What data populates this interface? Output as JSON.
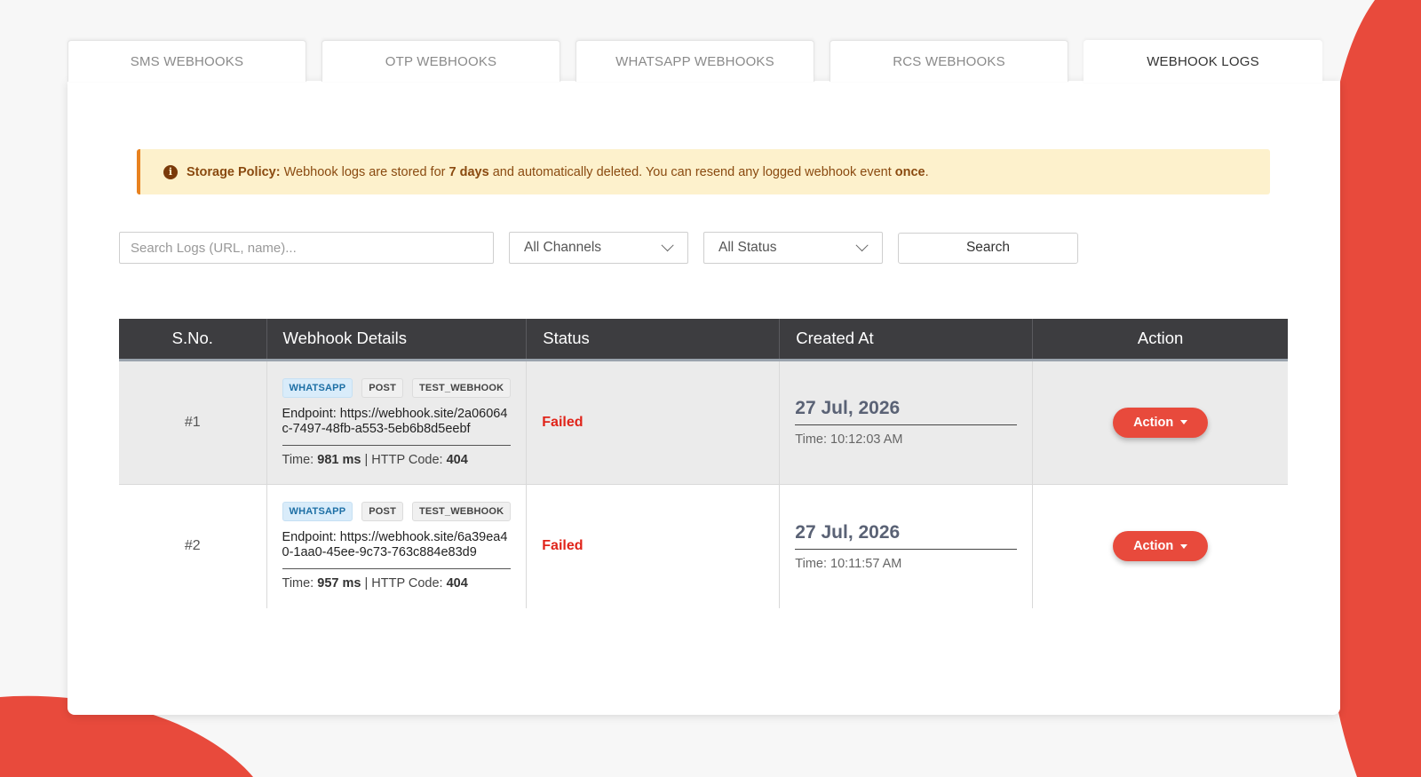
{
  "colors": {
    "accent": "#e84a3c",
    "notice_bg": "#fdf1cc",
    "notice_border": "#e8821f",
    "header_bg": "#3d3d40",
    "failed": "#e0241a"
  },
  "tabs": [
    {
      "label": "SMS WEBHOOKS",
      "active": false
    },
    {
      "label": "OTP WEBHOOKS",
      "active": false
    },
    {
      "label": "WHATSAPP WEBHOOKS",
      "active": false
    },
    {
      "label": "RCS WEBHOOKS",
      "active": false
    },
    {
      "label": "WEBHOOK LOGS",
      "active": true
    }
  ],
  "notice": {
    "icon": "info-icon",
    "title": "Storage Policy:",
    "text_1": " Webhook logs are stored for ",
    "days": "7 days",
    "text_2": " and automatically deleted. You can resend any logged webhook event ",
    "once": "once",
    "text_3": "."
  },
  "filters": {
    "search_placeholder": "Search Logs (URL, name)...",
    "search_value": "",
    "channel_selected": "All Channels",
    "status_selected": "All Status",
    "search_button": "Search"
  },
  "table": {
    "headers": [
      "S.No.",
      "Webhook Details",
      "Status",
      "Created At",
      "Action"
    ],
    "rows": [
      {
        "sno": "#1",
        "channel": "WHATSAPP",
        "method": "POST",
        "name": "TEST_WEBHOOK",
        "endpoint": "Endpoint: https://webhook.site/2a06064c-7497-48fb-a553-5eb6b8d5eebf",
        "time_label": "Time: ",
        "time_value": "981 ms",
        "http_label": " | HTTP Code: ",
        "http_code": "404",
        "status": "Failed",
        "date": "27 Jul, 2026",
        "time": "Time: 10:12:03 AM",
        "action": "Action"
      },
      {
        "sno": "#2",
        "channel": "WHATSAPP",
        "method": "POST",
        "name": "TEST_WEBHOOK",
        "endpoint": "Endpoint: https://webhook.site/6a39ea40-1aa0-45ee-9c73-763c884e83d9",
        "time_label": "Time: ",
        "time_value": "957 ms",
        "http_label": " | HTTP Code: ",
        "http_code": "404",
        "status": "Failed",
        "date": "27 Jul, 2026",
        "time": "Time: 10:11:57 AM",
        "action": "Action"
      }
    ]
  }
}
